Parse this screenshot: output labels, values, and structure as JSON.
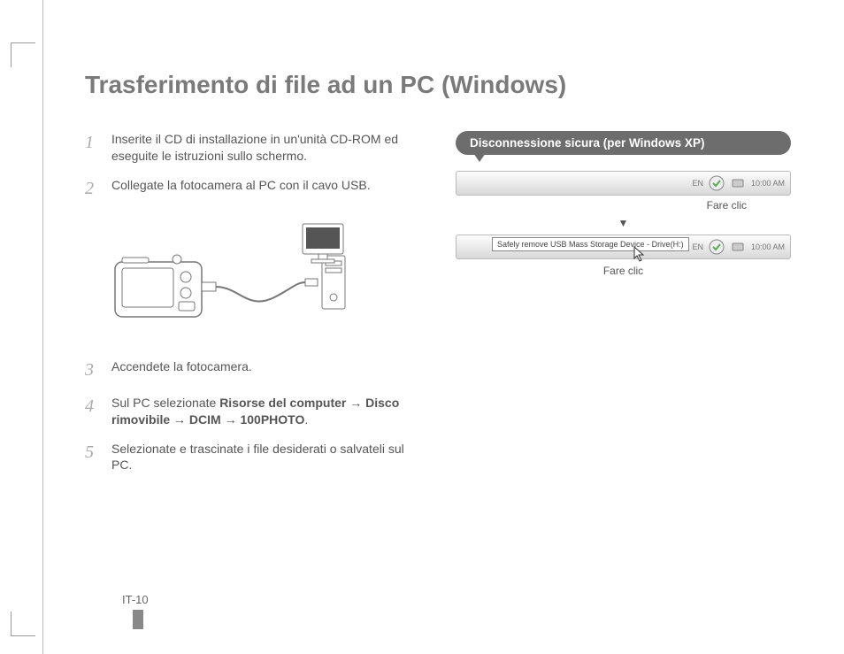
{
  "title": "Trasferimento di file ad un PC (Windows)",
  "steps": {
    "s1": {
      "num": "1",
      "text": "Inserite il CD di installazione in un'unità CD-ROM ed eseguite le istruzioni sullo schermo."
    },
    "s2": {
      "num": "2",
      "text": "Collegate la fotocamera al PC con il cavo USB."
    },
    "s3": {
      "num": "3",
      "text": "Accendete la fotocamera."
    },
    "s4": {
      "num": "4",
      "prefix": "Sul PC selezionate ",
      "b1": "Risorse del computer",
      "arrow": " → ",
      "b2": "Disco rimovibile",
      "b3": "DCIM",
      "b4": "100PHOTO",
      "suffix": "."
    },
    "s5": {
      "num": "5",
      "text": "Selezionate e trascinate i file desiderati o salvateli sul PC."
    }
  },
  "callout": {
    "title": "Disconnessione sicura (per Windows XP)"
  },
  "tray": {
    "lang": "EN",
    "time": "10:00 AM",
    "tooltip": "Safely remove USB Mass Storage Device - Drive(H:)"
  },
  "labels": {
    "click1": "Fare clic",
    "click2": "Fare clic",
    "flowArrow": "▼"
  },
  "pageNumber": "IT-10"
}
